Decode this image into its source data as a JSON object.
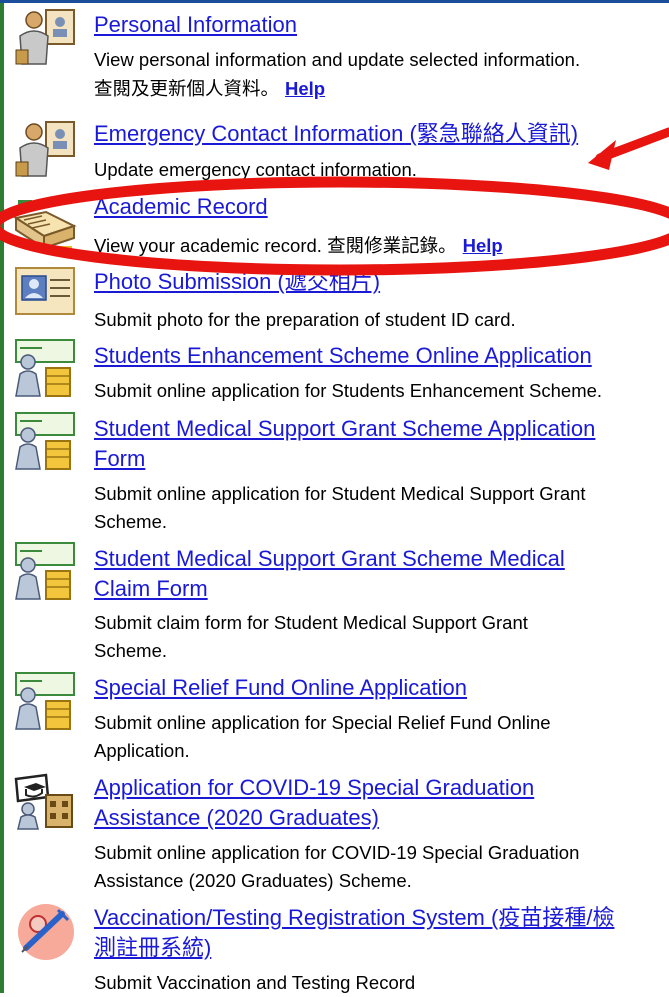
{
  "items": [
    {
      "title": "Personal Information",
      "desc": [
        "View personal information and update selected information.",
        "查閱及更新個人資料。"
      ],
      "help": "Help"
    },
    {
      "title": "Emergency Contact Information (緊急聯絡人資訊)",
      "desc": [
        "Update emergency contact information."
      ]
    },
    {
      "title": "Academic Record",
      "desc": [
        "View your academic record. 查閱修業記錄。"
      ],
      "help": "Help"
    },
    {
      "title": "Photo Submission (遞交相片)",
      "desc": [
        "Submit photo for the preparation of student ID card."
      ]
    },
    {
      "title": "Students Enhancement Scheme Online Application",
      "desc": [
        "Submit online application for Students Enhancement Scheme."
      ]
    },
    {
      "title": [
        "Student Medical Support Grant Scheme Application",
        "Form"
      ],
      "desc": [
        "Submit online application for Student Medical Support Grant",
        "Scheme."
      ]
    },
    {
      "title": [
        "Student Medical Support Grant Scheme Medical",
        "Claim Form"
      ],
      "desc": [
        "Submit claim form for Student Medical Support Grant",
        "Scheme."
      ]
    },
    {
      "title": "Special Relief Fund Online Application",
      "desc": [
        "Submit online application for Special Relief Fund Online",
        "Application."
      ]
    },
    {
      "title": [
        "Application for COVID-19 Special Graduation",
        "Assistance (2020 Graduates)"
      ],
      "desc": [
        "Submit online application for COVID-19 Special Graduation",
        "Assistance (2020 Graduates) Scheme."
      ]
    },
    {
      "title": [
        "Vaccination/Testing Registration System (疫苗接種/檢",
        "測註冊系統)"
      ],
      "desc": [
        "Submit Vaccination and Testing Record"
      ]
    }
  ],
  "colors": {
    "link": "#1a1ad6",
    "annotation": "#e8140f",
    "frame_left": "#2e7d32"
  },
  "icons": [
    "person-card-icon",
    "person-card-icon",
    "open-book-icon",
    "photo-card-icon",
    "grant-people-icon",
    "grant-people-icon",
    "grant-people-icon",
    "grant-people-icon",
    "graduation-building-icon",
    "vaccination-syringe-icon"
  ]
}
